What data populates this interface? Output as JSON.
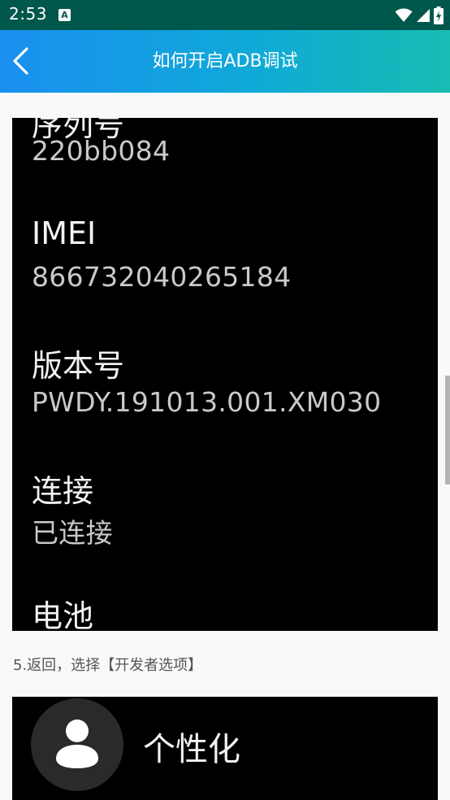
{
  "status_bar": {
    "time": "2:53",
    "notification_icon": "a-icon",
    "icons": [
      "wifi-icon",
      "signal-icon",
      "battery-charging-icon"
    ]
  },
  "app_bar": {
    "back_icon": "back-arrow-icon",
    "title": "如何开启ADB调试"
  },
  "screenshot_1": {
    "cropped_top_label": "序列号",
    "items": [
      {
        "label": "",
        "value": "220bb084"
      },
      {
        "label": "IMEI",
        "value": "866732040265184"
      },
      {
        "label": "版本号",
        "value": "PWDY.191013.001.XM030"
      },
      {
        "label": "连接",
        "value": "已连接"
      },
      {
        "label": "电池",
        "value": ""
      }
    ]
  },
  "step_5": {
    "text": "5.返回，选择【开发者选项】"
  },
  "screenshot_2": {
    "icon": "person-icon",
    "label": "个性化"
  },
  "colors": {
    "status_bar": "#00574b",
    "app_bar_start": "#1a8ff0",
    "app_bar_end": "#18bcb2",
    "content_bg": "#f9f9f9",
    "screenshot_bg": "#000000"
  }
}
